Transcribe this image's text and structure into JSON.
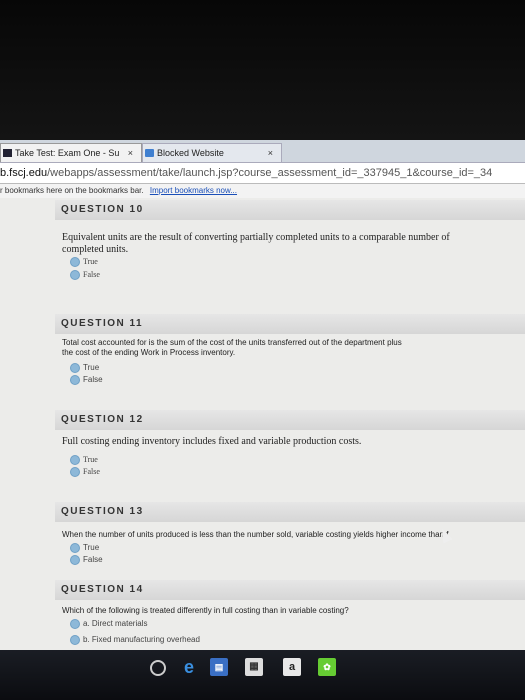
{
  "browser": {
    "tabs": [
      {
        "title": "Take Test: Exam One - Su"
      },
      {
        "title": "Blocked Website"
      }
    ],
    "tab_close": "×",
    "url_host": "b.fscj.edu",
    "url_path": "/webapps/assessment/take/launch.jsp?course_assessment_id=_337945_1&course_id=_34",
    "bookmarks_text": "r bookmarks here on the bookmarks bar.",
    "bookmarks_link": "Import bookmarks now..."
  },
  "questions": [
    {
      "header": "QUESTION 10",
      "text": "Equivalent units are the result of converting partially completed units to a comparable number of completed units.",
      "options": [
        "True",
        "False"
      ]
    },
    {
      "header": "QUESTION 11",
      "text": "Total cost accounted for is the sum of the cost of the units transferred out of the department plus the cost of the ending Work in Process inventory.",
      "options": [
        "True",
        "False"
      ]
    },
    {
      "header": "QUESTION 12",
      "text": "Full costing ending inventory includes fixed and variable production costs.",
      "options": [
        "True",
        "False"
      ]
    },
    {
      "header": "QUESTION 13",
      "text": "When the number of units produced is less than the number sold, variable costing yields higher income than f",
      "options": [
        "True",
        "False"
      ]
    },
    {
      "header": "QUESTION 14",
      "text": "Which of the following is treated differently in full costing than in variable costing?",
      "options": [
        "a. Direct materials",
        "b. Fixed manufacturing overhead"
      ]
    }
  ],
  "taskbar": {
    "icons": [
      "task-view-icon",
      "edge-icon",
      "store-icon",
      "amazon-icon"
    ],
    "amazon_label": "a"
  }
}
